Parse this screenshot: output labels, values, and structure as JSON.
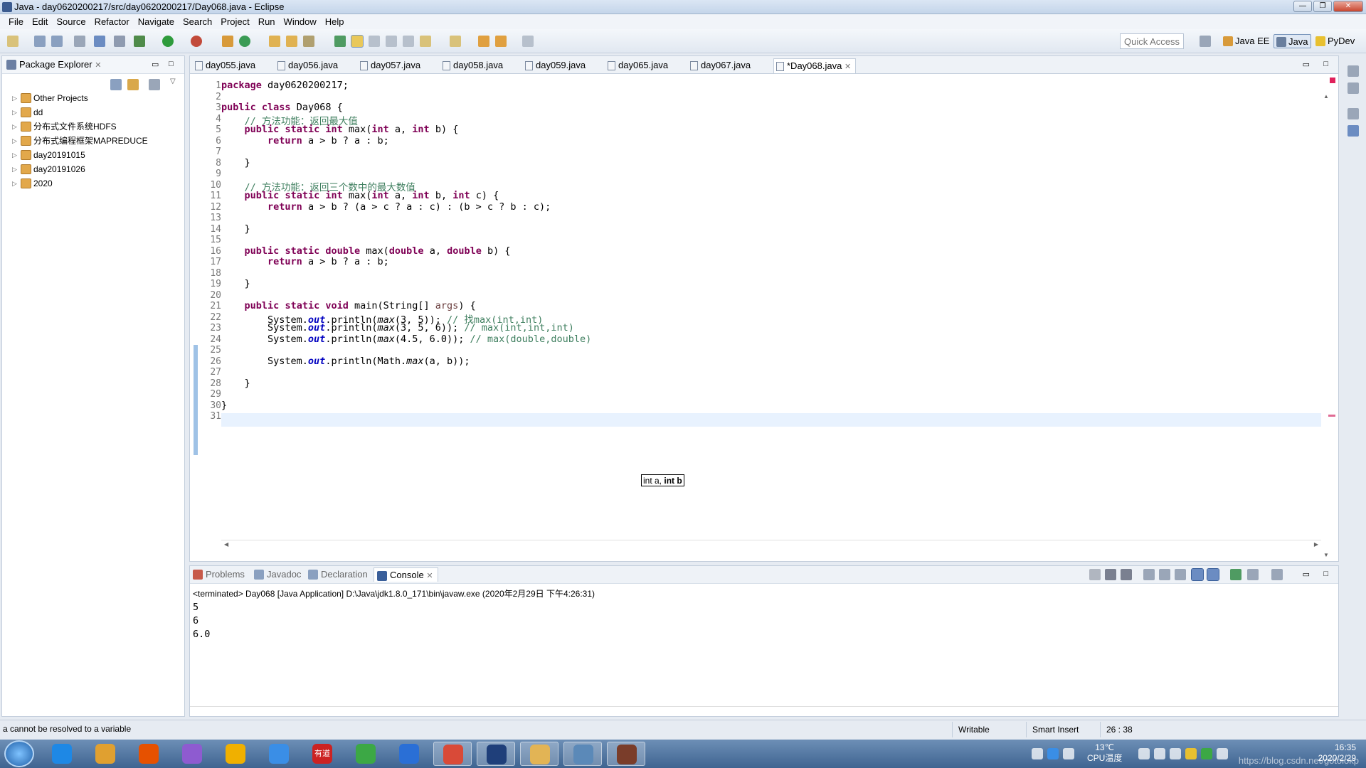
{
  "window": {
    "title": "Java - day0620200217/src/day0620200217/Day068.java - Eclipse",
    "minimize": "—",
    "maximize": "❐",
    "close": "✕"
  },
  "menu": [
    "File",
    "Edit",
    "Source",
    "Refactor",
    "Navigate",
    "Search",
    "Project",
    "Run",
    "Window",
    "Help"
  ],
  "toolbar": {
    "quick_access_placeholder": "Quick Access",
    "perspectives": [
      "Java EE",
      "Java",
      "PyDev"
    ],
    "active_perspective": "Java"
  },
  "package_explorer": {
    "tab_label": "Package Explorer",
    "close_glyph": "✕",
    "items": [
      "Other Projects",
      "dd",
      "分布式文件系统HDFS",
      "分布式编程框架MAPREDUCE",
      "day20191015",
      "day20191026",
      "2020"
    ]
  },
  "editor": {
    "close_glyph": "✕",
    "tabs": [
      "day055.java",
      "day056.java",
      "day057.java",
      "day058.java",
      "day059.java",
      "day065.java",
      "day067.java",
      "*Day068.java"
    ],
    "active_tab": "*Day068.java",
    "tooltip_plain": "int a, ",
    "tooltip_bold": "int b",
    "lines": [
      {
        "n": "1",
        "t": "package day0620200217;"
      },
      {
        "n": "2",
        "t": ""
      },
      {
        "n": "3",
        "t": "public class Day068 {"
      },
      {
        "n": "4",
        "t": "    // 方法功能：返回最大值"
      },
      {
        "n": "5",
        "t": "    public static int max(int a, int b) {"
      },
      {
        "n": "6",
        "t": "        return a > b ? a : b;"
      },
      {
        "n": "7",
        "t": ""
      },
      {
        "n": "8",
        "t": "    }"
      },
      {
        "n": "9",
        "t": ""
      },
      {
        "n": "10",
        "t": "    // 方法功能：返回三个数中的最大数值"
      },
      {
        "n": "11",
        "t": "    public static int max(int a, int b, int c) {"
      },
      {
        "n": "12",
        "t": "        return a > b ? (a > c ? a : c) : (b > c ? b : c);"
      },
      {
        "n": "13",
        "t": ""
      },
      {
        "n": "14",
        "t": "    }"
      },
      {
        "n": "15",
        "t": ""
      },
      {
        "n": "16",
        "t": "    public static double max(double a, double b) {"
      },
      {
        "n": "17",
        "t": "        return a > b ? a : b;"
      },
      {
        "n": "18",
        "t": ""
      },
      {
        "n": "19",
        "t": "    }"
      },
      {
        "n": "20",
        "t": ""
      },
      {
        "n": "21",
        "t": "    public static void main(String[] args) {"
      },
      {
        "n": "22",
        "t": "        System.out.println(max(3, 5)); // 找max(int,int)"
      },
      {
        "n": "23",
        "t": "        System.out.println(max(3, 5, 6)); // max(int,int,int)"
      },
      {
        "n": "24",
        "t": "        System.out.println(max(4.5, 6.0)); // max(double,double)"
      },
      {
        "n": "25",
        "t": ""
      },
      {
        "n": "26",
        "t": "        System.out.println(Math.max(a, b));"
      },
      {
        "n": "27",
        "t": ""
      },
      {
        "n": "28",
        "t": "    }"
      },
      {
        "n": "29",
        "t": ""
      },
      {
        "n": "30",
        "t": "}"
      },
      {
        "n": "31",
        "t": ""
      }
    ]
  },
  "console": {
    "tabs": [
      "Problems",
      "Javadoc",
      "Declaration",
      "Console"
    ],
    "active_tab": "Console",
    "close_glyph": "✕",
    "description": "<terminated> Day068 [Java Application] D:\\Java\\jdk1.8.0_171\\bin\\javaw.exe (2020年2月29日 下午4:26:31)",
    "output": [
      "5",
      "6",
      "6.0"
    ]
  },
  "status": {
    "message": "a cannot be resolved to a variable",
    "mode": "Writable",
    "insert": "Smart Insert",
    "position": "26 : 38"
  },
  "taskbar": {
    "temperature": "13℃",
    "cpu_label": "CPU温度",
    "time": "16:35",
    "date": "2020/2/29",
    "watermark": "https://blog.csdn.net/gotoiokp",
    "youdao_label": "有道",
    "app_colors": [
      "#1e88e5",
      "#e0a030",
      "#e65100",
      "#8e5bd0",
      "#f0b000",
      "#3a8ee6",
      "#cc2222",
      "#3ca845",
      "#2a6fd6",
      "#d94a38",
      "#1f3f7a",
      "#e2b455",
      "#5b89b8",
      "#7a3d2a"
    ]
  },
  "colors": {
    "keyword": "#7f0055",
    "comment": "#3f7f5f",
    "static_field": "#0000c0",
    "current_line": "#e8f2fe"
  }
}
